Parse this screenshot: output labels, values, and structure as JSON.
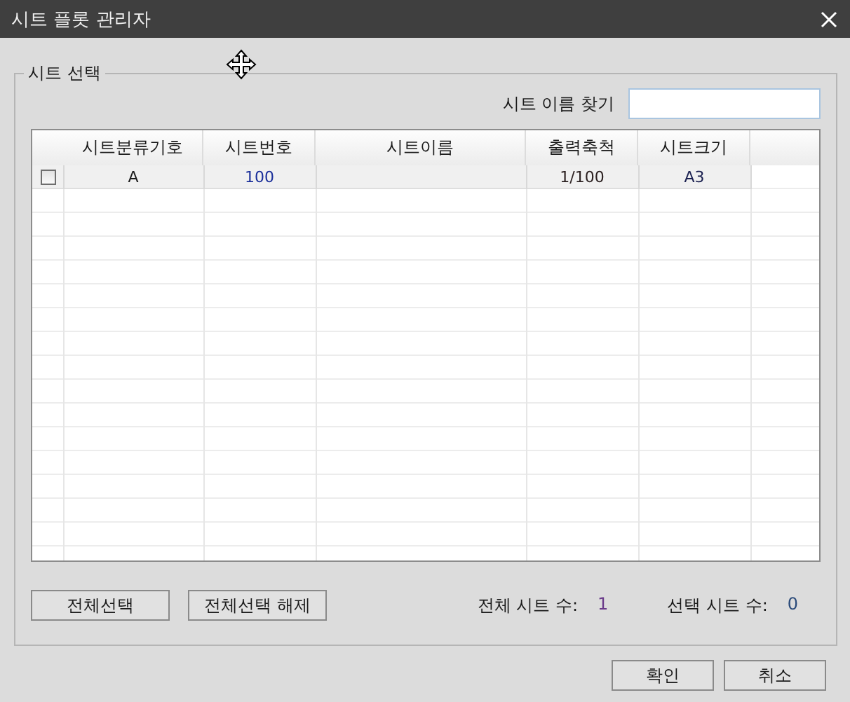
{
  "window": {
    "title": "시트 플롯 관리자"
  },
  "group": {
    "legend": "시트 선택"
  },
  "search": {
    "label": "시트 이름 찾기"
  },
  "table": {
    "columns": [
      "시트분류기호",
      "시트번호",
      "시트이름",
      "출력축척",
      "시트크기"
    ],
    "rows": [
      {
        "checked": false,
        "cells": [
          "A",
          "100",
          "",
          "1/100",
          "A3"
        ]
      }
    ]
  },
  "selection_buttons": [
    "전체선택",
    "전체선택 해제"
  ],
  "counts": [
    {
      "label": "전체 시트 수:",
      "value": "1"
    },
    {
      "label": "선택 시트 수:",
      "value": "0"
    }
  ],
  "dialog_buttons": [
    "확인",
    "취소"
  ]
}
